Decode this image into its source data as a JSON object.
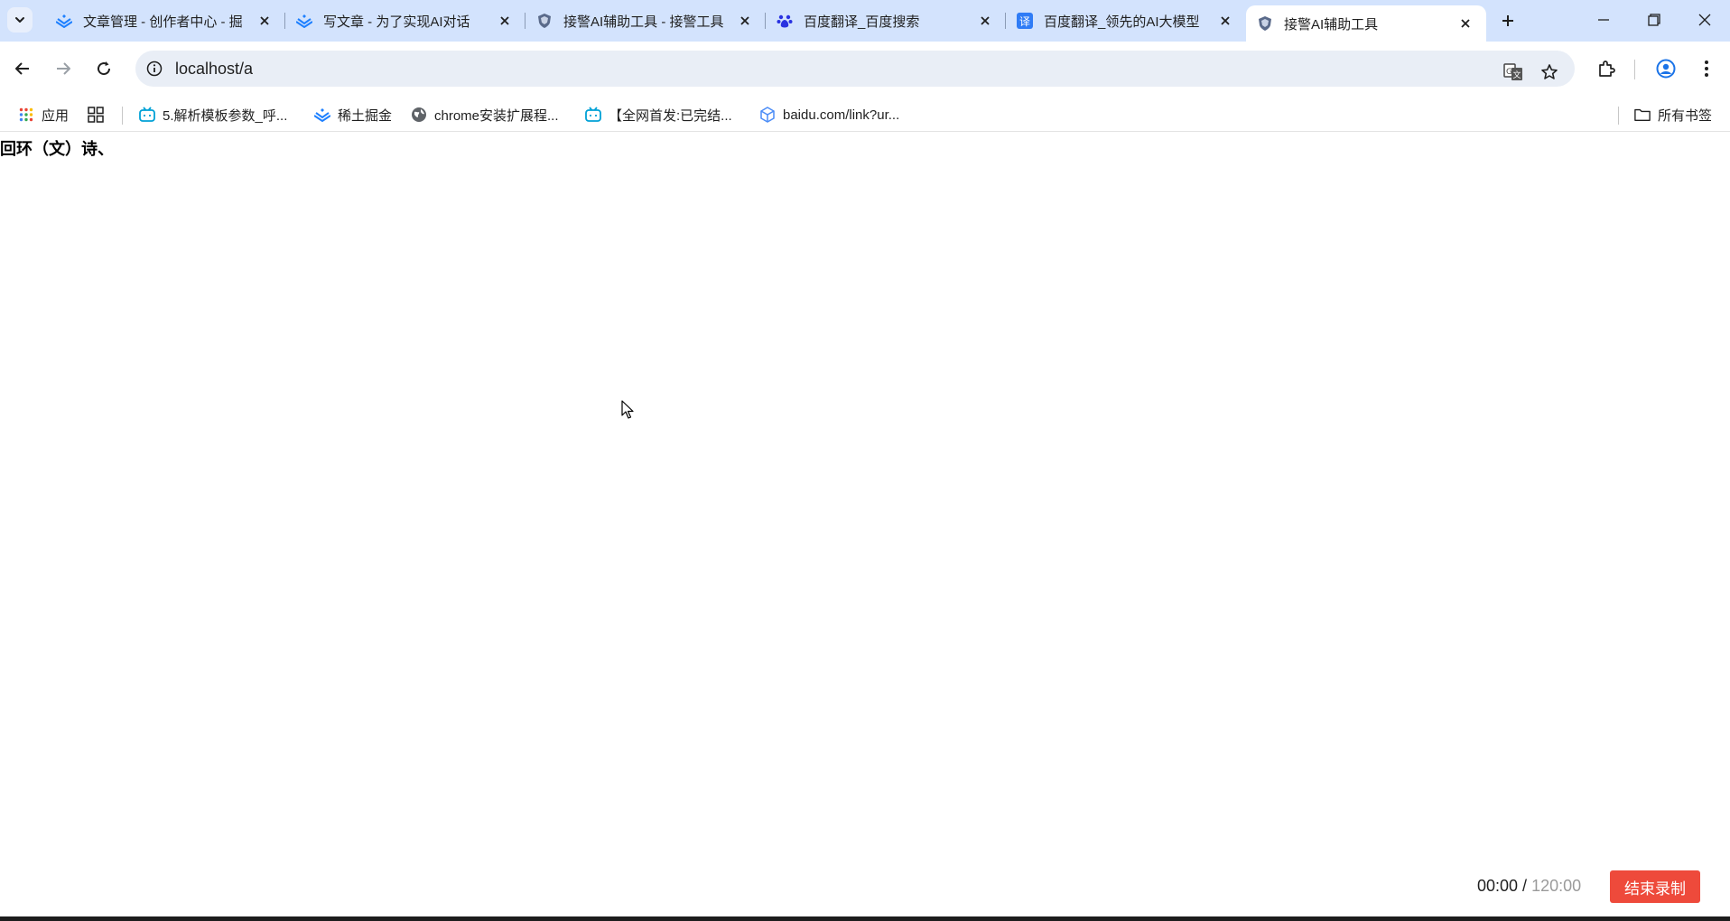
{
  "tabs": [
    {
      "title": "文章管理 - 创作者中心 - 掘",
      "favicon": "juejin-icon",
      "active": false
    },
    {
      "title": "写文章 - 为了实现AI对话",
      "favicon": "juejin-icon",
      "active": false
    },
    {
      "title": "接警AI辅助工具 - 接警工具",
      "favicon": "shield-icon",
      "active": false
    },
    {
      "title": "百度翻译_百度搜索",
      "favicon": "baidu-paw-icon",
      "active": false
    },
    {
      "title": "百度翻译_领先的AI大模型",
      "favicon": "baidu-translate-icon",
      "active": false
    },
    {
      "title": "接警AI辅助工具",
      "favicon": "shield-icon",
      "active": true
    }
  ],
  "address_bar": {
    "url": "localhost/a"
  },
  "bookmarks": [
    {
      "label": "应用",
      "icon": "apps-grid-icon"
    },
    {
      "label": "",
      "icon": "grid-icon"
    },
    {
      "label": "5.解析模板参数_呼...",
      "icon": "bilibili-icon"
    },
    {
      "label": "稀土掘金",
      "icon": "juejin-icon"
    },
    {
      "label": "chrome安装扩展程...",
      "icon": "globe-icon"
    },
    {
      "label": "【全网首发:已完结...",
      "icon": "bilibili-icon"
    },
    {
      "label": "baidu.com/link?ur...",
      "icon": "cube-icon"
    }
  ],
  "bookmarks_folder": {
    "label": "所有书签",
    "icon": "folder-icon"
  },
  "page": {
    "text": "回环（文）诗、",
    "timer_current": "00:00",
    "timer_separator": " / ",
    "timer_limit": "120:00",
    "end_button_label": "结束录制"
  },
  "colors": {
    "tabstrip_bg": "#d3e3fd",
    "omnibox_bg": "#e9eef6",
    "end_button_bg": "#ee4a3b",
    "accent_blue": "#1a73e8"
  }
}
